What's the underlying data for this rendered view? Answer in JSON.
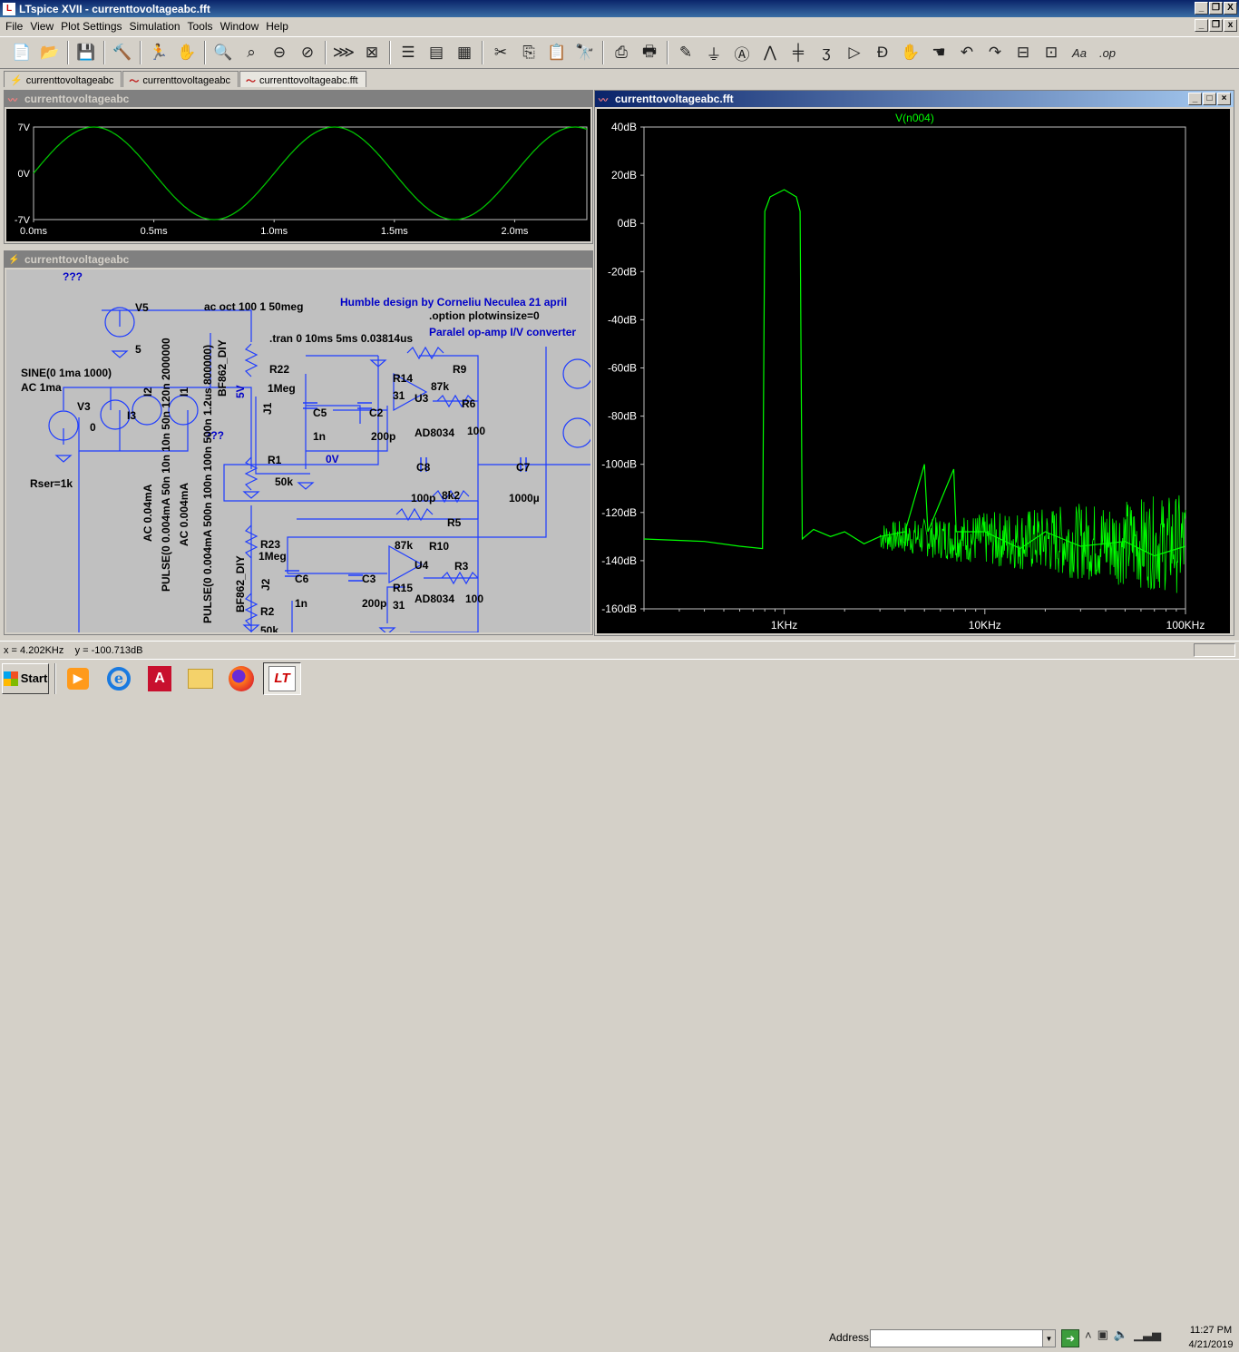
{
  "window": {
    "title": "LTspice XVII - currenttovoltageabc.fft",
    "app_icon_letter": "L",
    "minimize": "_",
    "restore": "❐",
    "close": "X"
  },
  "menu": [
    "File",
    "View",
    "Plot Settings",
    "Simulation",
    "Tools",
    "Window",
    "Help"
  ],
  "menu_right": {
    "minimize": "_",
    "restore": "❐",
    "close": "x"
  },
  "toolbar": [
    {
      "name": "new-schematic-icon",
      "glyph": "📄"
    },
    {
      "name": "open-icon",
      "glyph": "📂"
    },
    {
      "sep": true
    },
    {
      "name": "save-icon",
      "glyph": "💾"
    },
    {
      "sep": true
    },
    {
      "name": "control-panel-icon",
      "glyph": "🔨"
    },
    {
      "sep": true
    },
    {
      "name": "run-icon",
      "glyph": "🏃"
    },
    {
      "name": "halt-icon",
      "glyph": "✋"
    },
    {
      "sep": true
    },
    {
      "name": "zoom-in-icon",
      "glyph": "🔍"
    },
    {
      "name": "zoom-pan-icon",
      "glyph": "⌕"
    },
    {
      "name": "zoom-out-icon",
      "glyph": "⊖"
    },
    {
      "name": "zoom-fit-icon",
      "glyph": "⊘"
    },
    {
      "sep": true
    },
    {
      "name": "autorange-icon",
      "glyph": "⋙"
    },
    {
      "name": "delete-trace-icon",
      "glyph": "⊠"
    },
    {
      "sep": true
    },
    {
      "name": "tile-horizontal-icon",
      "glyph": "☰"
    },
    {
      "name": "tile-vertical-icon",
      "glyph": "▤"
    },
    {
      "name": "cascade-icon",
      "glyph": "▦"
    },
    {
      "sep": true
    },
    {
      "name": "cut-icon",
      "glyph": "✂"
    },
    {
      "name": "copy-icon",
      "glyph": "⎘"
    },
    {
      "name": "paste-icon",
      "glyph": "📋"
    },
    {
      "name": "find-icon",
      "glyph": "🔭"
    },
    {
      "sep": true
    },
    {
      "name": "print-setup-icon",
      "glyph": "⎙"
    },
    {
      "name": "print-icon",
      "glyph": "🖶"
    },
    {
      "sep": true
    },
    {
      "name": "draw-wire-icon",
      "glyph": "✎"
    },
    {
      "name": "ground-icon",
      "glyph": "⏚"
    },
    {
      "name": "label-net-icon",
      "glyph": "Ⓐ"
    },
    {
      "name": "resistor-icon",
      "glyph": "⋀"
    },
    {
      "name": "capacitor-icon",
      "glyph": "╪"
    },
    {
      "name": "inductor-icon",
      "glyph": "ʒ"
    },
    {
      "name": "diode-icon",
      "glyph": "▷"
    },
    {
      "name": "component-icon",
      "glyph": "Ð"
    },
    {
      "name": "move-icon",
      "glyph": "✋"
    },
    {
      "name": "drag-icon",
      "glyph": "☚"
    },
    {
      "name": "undo-icon",
      "glyph": "↶"
    },
    {
      "name": "redo-icon",
      "glyph": "↷"
    },
    {
      "name": "rotate-icon",
      "glyph": "⊟"
    },
    {
      "name": "mirror-icon",
      "glyph": "⊡"
    },
    {
      "name": "text-icon",
      "glyph": "Aa"
    },
    {
      "name": "spice-directive-icon",
      "glyph": ".op"
    }
  ],
  "tabs": [
    {
      "label": "currenttovoltageabc",
      "icon": "schematic-icon",
      "glyph": "⚡"
    },
    {
      "label": "currenttovoltageabc",
      "icon": "waveform-icon",
      "glyph": "〜"
    },
    {
      "label": "currenttovoltageabc.fft",
      "icon": "waveform-icon",
      "glyph": "〜"
    }
  ],
  "waveform_panel": {
    "title": "currenttovoltageabc",
    "y_ticks": [
      "7V",
      "0V",
      "-7V"
    ],
    "x_ticks": [
      "0.0ms",
      "0.5ms",
      "1.0ms",
      "1.5ms",
      "2.0ms"
    ],
    "trace_color": "#00c000"
  },
  "schematic_panel": {
    "title": "currenttovoltageabc",
    "labels": [
      {
        "t": "???"
      },
      {
        "t": "V5"
      },
      {
        "t": "5"
      },
      {
        "t": "SINE(0 1ma 1000)"
      },
      {
        "t": "AC 1ma"
      },
      {
        "t": "V3"
      },
      {
        "t": "0"
      },
      {
        "t": "I3"
      },
      {
        "t": "I2"
      },
      {
        "t": "I1"
      },
      {
        "t": "Rser=1k"
      },
      {
        "t": "ac oct 100 1 50meg"
      },
      {
        "t": ".tran 0 10ms 5ms 0.03814us"
      },
      {
        "t": "Humble design by Corneliu Neculea 21 april"
      },
      {
        "t": ".option plotwinsize=0"
      },
      {
        "t": "Paralel op-amp I/V converter"
      },
      {
        "t": "R22"
      },
      {
        "t": "1Meg"
      },
      {
        "t": "5V"
      },
      {
        "t": "J1"
      },
      {
        "t": "C5"
      },
      {
        "t": "1n"
      },
      {
        "t": "C2"
      },
      {
        "t": "200p"
      },
      {
        "t": "R14"
      },
      {
        "t": "31"
      },
      {
        "t": "87k"
      },
      {
        "t": "R9"
      },
      {
        "t": "U3"
      },
      {
        "t": "R6"
      },
      {
        "t": "100"
      },
      {
        "t": "AD8034"
      },
      {
        "t": "R1"
      },
      {
        "t": "50k"
      },
      {
        "t": "0V"
      },
      {
        "t": "C8"
      },
      {
        "t": "100p"
      },
      {
        "t": "8k2"
      },
      {
        "t": "R5"
      },
      {
        "t": "C7"
      },
      {
        "t": "1000µ"
      },
      {
        "t": "87k"
      },
      {
        "t": "R10"
      },
      {
        "t": "R23"
      },
      {
        "t": "1Meg"
      },
      {
        "t": "C6"
      },
      {
        "t": "1n"
      },
      {
        "t": "C3"
      },
      {
        "t": "200p"
      },
      {
        "t": "R15"
      },
      {
        "t": "31"
      },
      {
        "t": "U4"
      },
      {
        "t": "R3"
      },
      {
        "t": "100"
      },
      {
        "t": "AD8034"
      },
      {
        "t": "J2"
      },
      {
        "t": "R2"
      },
      {
        "t": "50k"
      },
      {
        "t": "???"
      },
      {
        "t": "BF862_DIY"
      },
      {
        "t": "BF862_DIY"
      },
      {
        "t": "AC 0.04mA"
      },
      {
        "t": "PULSE(0 0.004mA 50n 10n 10n 50n 120n 2000000"
      },
      {
        "t": "AC 0.004mA"
      },
      {
        "t": "PULSE(0 0.004mA 500n 100n 100n 500n 1.2us 800000)"
      }
    ]
  },
  "fft_panel": {
    "title": "currenttovoltageabc.fft",
    "trace_name": "V(n004)",
    "trace_color": "#00ff00",
    "y_ticks": [
      "40dB",
      "20dB",
      "0dB",
      "-20dB",
      "-40dB",
      "-60dB",
      "-80dB",
      "-100dB",
      "-120dB",
      "-140dB",
      "-160dB"
    ],
    "x_ticks": [
      "1KHz",
      "10KHz",
      "100KHz"
    ]
  },
  "chart_data": [
    {
      "type": "line",
      "title": "",
      "x_unit": "ms",
      "xlim": [
        0,
        2.3
      ],
      "ylim": [
        -7,
        7
      ],
      "yticks": [
        "7V",
        "0V",
        "-7V"
      ],
      "xticks": [
        "0.0ms",
        "0.5ms",
        "1.0ms",
        "1.5ms",
        "2.0ms"
      ],
      "grid": false,
      "series": [
        {
          "amplitude": 7,
          "frequency_hz": 1000,
          "phase_deg": 0
        }
      ]
    },
    {
      "type": "line",
      "title": "",
      "x_scale": "log",
      "xlim": [
        200,
        100000
      ],
      "ylim": [
        -160,
        40
      ],
      "grid": false,
      "legend": "top-center",
      "series": [
        {
          "name": "V(n004)",
          "points": [
            [
              200,
              -131
            ],
            [
              400,
              -132
            ],
            [
              600,
              -134
            ],
            [
              780,
              -135
            ],
            [
              800,
              5
            ],
            [
              850,
              11
            ],
            [
              1000,
              14
            ],
            [
              1150,
              11
            ],
            [
              1200,
              5
            ],
            [
              1230,
              -131
            ],
            [
              1400,
              -127
            ],
            [
              1700,
              -130
            ],
            [
              2000,
              -128
            ],
            [
              2500,
              -133
            ],
            [
              3000,
              -130
            ],
            [
              4000,
              -128
            ],
            [
              5000,
              -100
            ],
            [
              5200,
              -128
            ],
            [
              7000,
              -102
            ],
            [
              7200,
              -128
            ],
            [
              10000,
              -128
            ],
            [
              15000,
              -135
            ],
            [
              20000,
              -128
            ],
            [
              30000,
              -134
            ],
            [
              50000,
              -132
            ],
            [
              70000,
              -138
            ],
            [
              100000,
              -134
            ]
          ]
        }
      ]
    }
  ],
  "status": {
    "cursor": "x = 4.202KHz    y = -100.713dB"
  },
  "taskbar": {
    "start": "Start",
    "address_label": "Address",
    "address_value": "",
    "clock_time": "11:27 PM",
    "clock_date": "4/21/2019"
  }
}
